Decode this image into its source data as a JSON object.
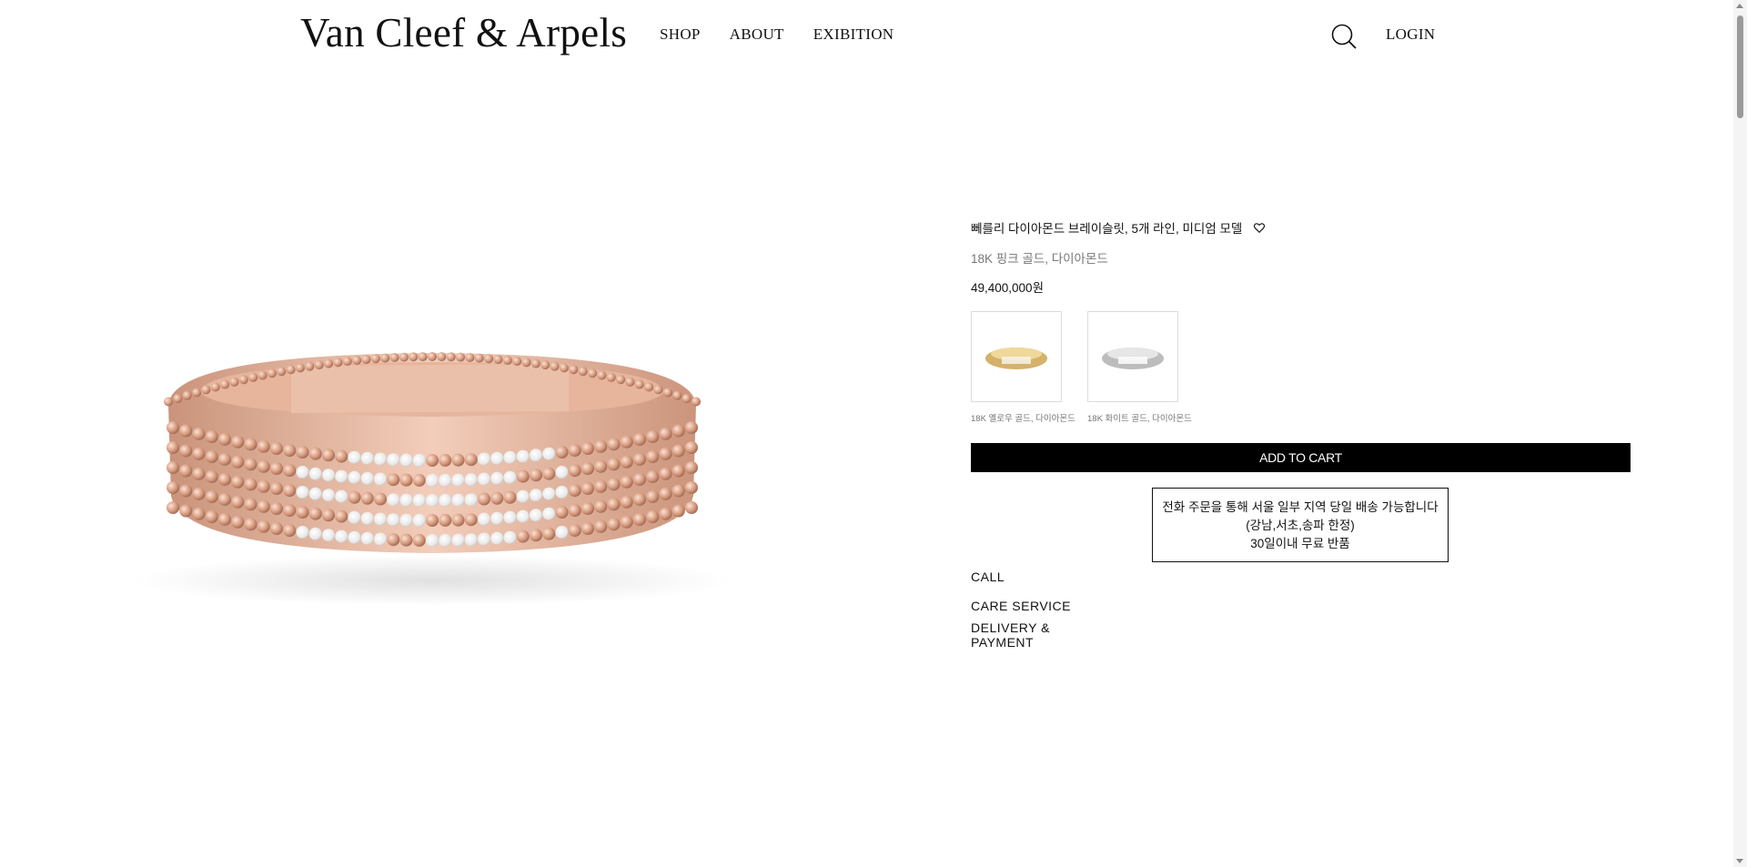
{
  "header": {
    "logo": "Van Cleef & Arpels",
    "nav": [
      {
        "label": "SHOP"
      },
      {
        "label": "ABOUT"
      },
      {
        "label": "EXIBITION"
      }
    ],
    "login_label": "LOGIN",
    "icons": {
      "search": "search-icon"
    }
  },
  "product": {
    "title": "뻬를리 다이아몬드 브레이슬릿, 5개 라인, 미디엄 모델",
    "material": "18K 핑크 골드, 다이아몬드",
    "price": "49,400,000원",
    "variants": [
      {
        "label": "18K 옐로우 골드, 다이아몬드",
        "color": "#d4b26a"
      },
      {
        "label": "18K 화이트 골드, 다이아몬드",
        "color": "#c8c8c8"
      }
    ],
    "main_color": "#d9a58a",
    "add_to_cart_label": "ADD TO CART",
    "notice": [
      "전화 주문을 통해 서울 일부 지역 당일 배송 가능합니다",
      "(강남,서초,송파 한정)",
      "30일이내 무료 반품"
    ],
    "info_links": [
      {
        "label": "CALL"
      },
      {
        "label": "CARE SERVICE"
      },
      {
        "label": "DELIVERY & PAYMENT"
      }
    ]
  }
}
